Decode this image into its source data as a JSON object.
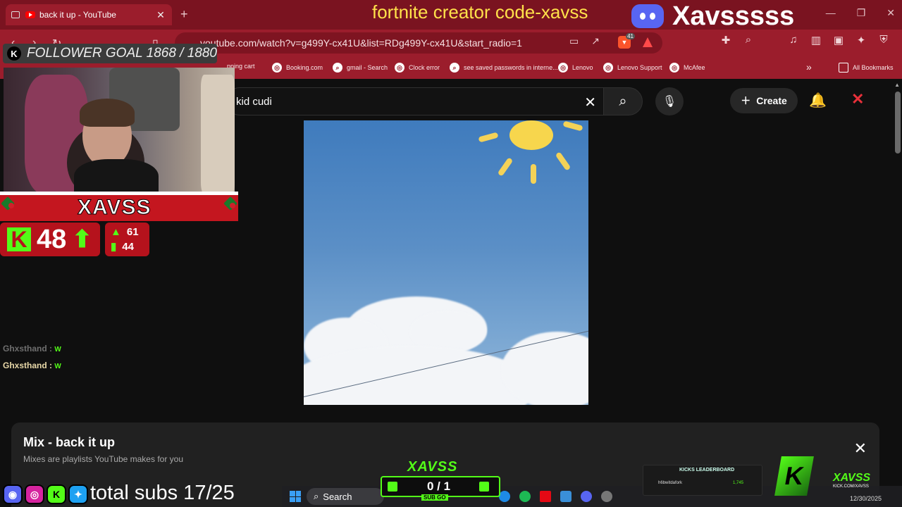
{
  "browser": {
    "tab_title": "back it up - YouTube",
    "url": "youtube.com/watch?v=g499Y-cx41U&list=RDg499Y-cx41U&start_radio=1",
    "brave_badge": "41",
    "bookmarks": [
      "pping cart",
      "Booking.com",
      "gmail - Search",
      "Clock error",
      "see saved passwords in interne...",
      "Lenovo",
      "Lenovo Support",
      "McAfee"
    ],
    "all_bookmarks": "All Bookmarks"
  },
  "youtube": {
    "search_value": "kid cudi",
    "create_label": "Create",
    "mix_title": "Mix - back it up",
    "mix_subtitle": "Mixes are playlists YouTube makes for you"
  },
  "overlay": {
    "banner": "fortnite creator code-xavss",
    "handle": "Xavsssss",
    "follower_goal": "FOLLOWER GOAL 1868 / 1880",
    "streamer_name": "XAVSS",
    "kick_followers": "48",
    "stat_top": "61",
    "stat_bottom": "44",
    "chat": [
      {
        "user": "Ghxsthand :",
        "emote": "W"
      },
      {
        "user": "Ghxsthand :",
        "emote": "W"
      }
    ],
    "subs_goal": "total subs 17/25",
    "subgoal_logo": "XAVSS",
    "subgoal_value": "0 / 1",
    "subgoal_caption": "SUB GO",
    "leaderboard_title": "KICKS LEADERBOARD",
    "leaderboard_user": "h6bwitdafork",
    "leaderboard_value": "1,745",
    "brand_name": "XAVSS",
    "brand_url": "KICK.COM/XAVSS"
  },
  "taskbar": {
    "search_label": "Search",
    "date": "12/30/2025"
  },
  "colors": {
    "browser_accent": "#9b1d2c",
    "kick_green": "#53fc18",
    "banner_yellow": "#ffe14a",
    "discord": "#5865f2"
  }
}
